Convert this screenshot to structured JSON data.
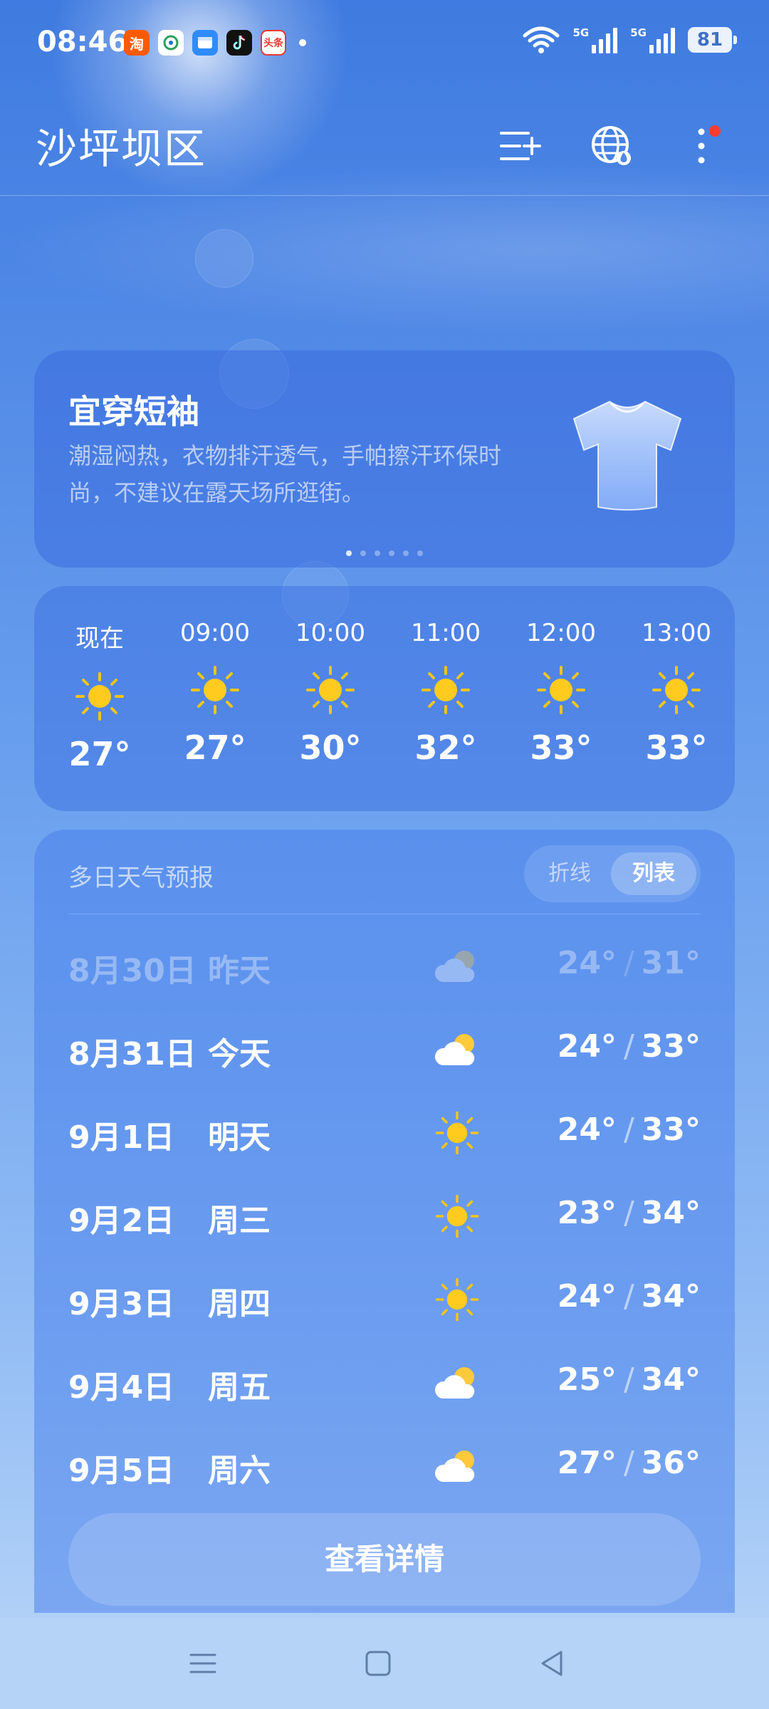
{
  "status_bar": {
    "time": "08:46",
    "apps": [
      {
        "name": "taobao-icon",
        "label": "淘",
        "color": "#ff5a00"
      },
      {
        "name": "china-mobile-icon",
        "label": "",
        "color": "#ffffff"
      },
      {
        "name": "message-app-icon",
        "label": "",
        "color": "#2f8cff"
      },
      {
        "name": "tiktok-icon",
        "label": "",
        "color": "#111111"
      },
      {
        "name": "toutiao-icon",
        "label": "头条",
        "color": "#e8372f"
      }
    ],
    "signal1": "5G",
    "signal2": "5G",
    "battery": "81"
  },
  "header": {
    "city": "沙坪坝区"
  },
  "tip": {
    "title": "宜穿短袖",
    "description": "潮湿闷热，衣物排汗透气，手帕擦汗环保时尚，不建议在露天场所逛街。",
    "pages": 6,
    "active_page": 0
  },
  "hourly": [
    {
      "time": "现在",
      "temp": "27°",
      "icon": "sun-icon"
    },
    {
      "time": "09:00",
      "temp": "27°",
      "icon": "sun-icon"
    },
    {
      "time": "10:00",
      "temp": "30°",
      "icon": "sun-icon"
    },
    {
      "time": "11:00",
      "temp": "32°",
      "icon": "sun-icon"
    },
    {
      "time": "12:00",
      "temp": "33°",
      "icon": "sun-icon"
    },
    {
      "time": "13:00",
      "temp": "33°",
      "icon": "sun-icon"
    }
  ],
  "daily": {
    "title": "多日天气预报",
    "toggle_line": "折线",
    "toggle_list": "列表",
    "rows": [
      {
        "date": "8月30日",
        "day": "昨天",
        "icon": "partly-cloudy-icon",
        "low": "24°",
        "high": "31°",
        "past": true
      },
      {
        "date": "8月31日",
        "day": "今天",
        "icon": "partly-cloudy-icon",
        "low": "24°",
        "high": "33°",
        "past": false
      },
      {
        "date": "9月1日",
        "day": "明天",
        "icon": "sun-icon",
        "low": "24°",
        "high": "33°",
        "past": false
      },
      {
        "date": "9月2日",
        "day": "周三",
        "icon": "sun-icon",
        "low": "23°",
        "high": "34°",
        "past": false
      },
      {
        "date": "9月3日",
        "day": "周四",
        "icon": "sun-icon",
        "low": "24°",
        "high": "34°",
        "past": false
      },
      {
        "date": "9月4日",
        "day": "周五",
        "icon": "partly-cloudy-icon",
        "low": "25°",
        "high": "34°",
        "past": false
      },
      {
        "date": "9月5日",
        "day": "周六",
        "icon": "partly-cloudy-icon",
        "low": "27°",
        "high": "36°",
        "past": false
      }
    ],
    "slash": "/",
    "details_button": "查看详情"
  }
}
